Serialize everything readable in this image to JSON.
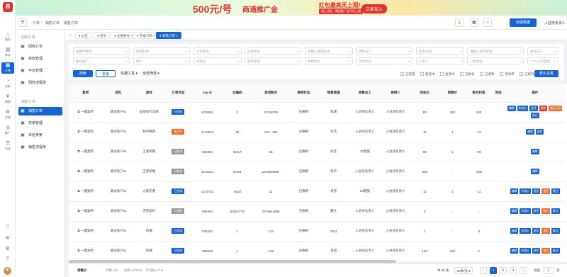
{
  "banner": {
    "big": "500元/号",
    "mid": "商通推广金",
    "red": "红包最高无上限!",
    "sub": "线上达标，赠送推广金不设上限",
    "cta": "立即加入"
  },
  "rail": {
    "logo": "易",
    "items": [
      {
        "glyph": "⌂",
        "label": "首页"
      },
      {
        "glyph": "▤",
        "label": "库存"
      },
      {
        "glyph": "▦",
        "label": "订单"
      },
      {
        "glyph": "◔",
        "label": "分析"
      },
      {
        "glyph": "¥",
        "label": "财务"
      },
      {
        "glyph": "⚙",
        "label": "工具"
      },
      {
        "glyph": "◎",
        "label": "推广"
      },
      {
        "glyph": "☰",
        "label": "日志"
      }
    ]
  },
  "breadcrumb": [
    "订单",
    "销售订单",
    "销售订单"
  ],
  "header": {
    "create_label": "创建数据",
    "user": "入驻块负责人"
  },
  "sidebar": {
    "group1": "回收订单",
    "items1": [
      "回收订单",
      "自收管理",
      "平台管理",
      "回收流程单"
    ],
    "group2": "销售订单",
    "items2": [
      "销售订单",
      "买家管理",
      "未验卖家",
      "销售流程单"
    ]
  },
  "tabs": [
    "公告",
    "首页",
    "全部账号",
    "回收订单",
    "销售订单"
  ],
  "filters": {
    "row1": [
      "关键字搜索",
      "游戏名称",
      "订单状态",
      "自收状态",
      "请输入游戏渠道",
      "销售员工",
      "是否分配",
      "请输入游戏渠道",
      "收号员工"
    ],
    "row2": [
      "帐号账户",
      "用户",
      "采购员",
      "账单渠道",
      "换绑状态",
      "交付状态",
      "入库人",
      "订单状态",
      "个人/公司渠道"
    ],
    "checks": [
      "已完成",
      "售后中",
      "出货中",
      "已换号",
      "已退款",
      "无效单",
      "已取消"
    ],
    "search": "搜索",
    "reset": "重置",
    "quick": "快捷工具",
    "all": "全部筛选",
    "settings": "表头设置"
  },
  "table": {
    "columns": [
      "复制",
      "团队",
      "游戏",
      "订单状态",
      "erp id",
      "自编码",
      "游戏账号",
      "换绑状态",
      "销售渠道",
      "销售员工",
      "换绑人",
      "回收价",
      "销售价",
      "账号利润",
      "回收",
      "操作"
    ],
    "rows": [
      {
        "copy": "一键复制",
        "team": "测试商户61",
        "game": "战地侦行动组",
        "status": "已完成",
        "erp": "1235091",
        "code": "2",
        "acct": "11762870",
        "bind": "已换绑",
        "channel": "私域",
        "staff": "入驻块负责人",
        "person": "入驻块负责人",
        "rec": "50",
        "sale": "150",
        "profit": "100",
        "r": ""
      },
      {
        "copy": "一键复制",
        "team": "测试商户61",
        "game": "和平精英",
        "status": "售后中",
        "erp": "1175849",
        "code": "39",
        "acct": "123...456",
        "bind": "已换绑",
        "channel": "抖音",
        "staff": "入驻块负责人",
        "person": "入驻块负责人",
        "rec": "11",
        "sale": "1",
        "profit": "-11",
        "r": ""
      },
      {
        "copy": "一键复制",
        "team": "测试商户61",
        "game": "王者荣耀",
        "status": "已取消",
        "erp": "820363",
        "code": "Wz17",
        "acct": "66",
        "bind": "已换绑",
        "channel": "抖音",
        "staff": "32客服",
        "person": "入驻块负责人",
        "rec": "99",
        "sale": "1",
        "profit": "-99",
        "r": ""
      },
      {
        "copy": "一键复制",
        "team": "测试商户61",
        "game": "王者荣耀",
        "status": "已取消",
        "erp": "1103115",
        "code": "Wz24",
        "acct": "1234565687",
        "bind": "已换绑",
        "channel": "快手",
        "staff": "入驻块负责人",
        "person": "入驻块负责人",
        "rec": "500",
        "sale": "-",
        "profit": "-500",
        "r": ""
      },
      {
        "copy": "一键复制",
        "team": "测试商户61",
        "game": "火影忍者",
        "status": "已完成",
        "erp": "1215722",
        "code": "Hy10",
        "acct": "11",
        "bind": "已换绑",
        "channel": "抖音",
        "staff": "63客服",
        "person": "入驻块负责人",
        "rec": "11",
        "sale": "1",
        "profit": "-11",
        "r": ""
      },
      {
        "copy": "一键复制",
        "team": "测试商户61",
        "game": "无畏契约",
        "status": "已退款",
        "erp": "958464",
        "code": "34561778",
        "acct": "2378642888",
        "bind": "已换绑",
        "channel": "霸主",
        "staff": "入驻块负责人",
        "person": "入驻块负责人",
        "rec": "0",
        "sale": "-",
        "profit": "-",
        "r": ""
      },
      {
        "copy": "一键复制",
        "team": "测试商户61",
        "game": "鸣潮",
        "status": "已完成",
        "erp": "929252",
        "code": "1",
        "acct": "123",
        "bind": "已换绑",
        "channel": "7881",
        "staff": "入驻块负责人",
        "person": "入驻块负责人",
        "rec": "1",
        "sale": "-",
        "profit": "-1",
        "r": ""
      },
      {
        "copy": "一键复制",
        "team": "测试商户61",
        "game": "鸣潮",
        "status": "已完成",
        "erp": "925509",
        "code": "1",
        "acct": "123",
        "bind": "已换绑",
        "channel": "其他",
        "staff": "入驻块负责人",
        "person": "入驻块负责人",
        "rec": "123",
        "sale": "125",
        "profit": "2",
        "r": ""
      }
    ]
  },
  "footer": {
    "label": "销售价",
    "stat1": "计数=10",
    "stat2": "总和=278.00",
    "stat3": "平均值=27.8",
    "total": "共 25 条",
    "per_page": "10条/页",
    "goto": "前往",
    "page_num": "1",
    "page_unit": "页"
  },
  "colors": {
    "primary": "#1565d8",
    "danger": "#e5322d",
    "warn": "#f56c2d",
    "gray": "#999999"
  }
}
